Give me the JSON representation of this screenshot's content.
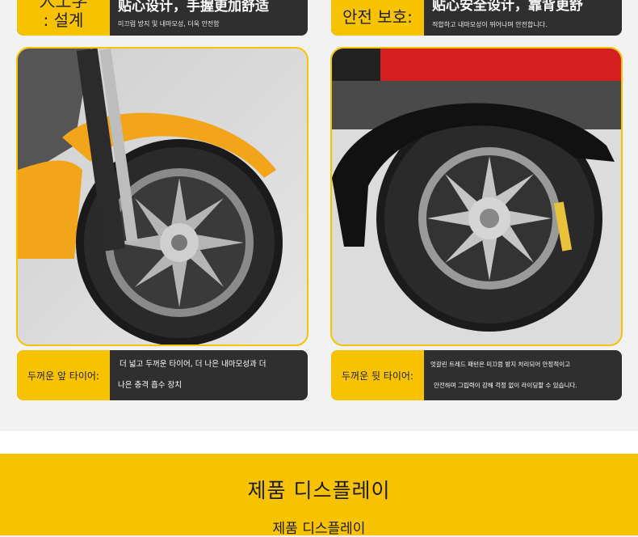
{
  "top_left": {
    "tag_line1": "人工学",
    "tag_line2": ": 설계",
    "title": "贴心设计，手握更加舒适",
    "subtitle": "미끄럼 방지 및 내마모성, 더욱 안전함"
  },
  "top_right": {
    "tag": "안전 보호:",
    "title": "贴心安全设计，靠背更舒",
    "subtitle": "적합하고 내마모성이 뛰어나며 안전합니다."
  },
  "bottom_left": {
    "tag": "두꺼운 앞 타이어:",
    "desc_line1": "더 넓고 두꺼운 타이어, 더 나은 내마모성과 더",
    "desc_line2": "나은 충격 흡수 장치"
  },
  "bottom_right": {
    "tag": "두꺼운 뒷 타이어:",
    "desc_line1": "엇갈린 트레드 패턴은 미끄럼 방지 처리되어 안정적이고",
    "desc_line2": "안전하며 그립력이 강해 걱정 없이 라이딩할 수 있습니다."
  },
  "display": {
    "title": "제품 디스플레이",
    "subtitle": "제품 디스플레이"
  },
  "colors": {
    "accent": "#f7c300",
    "bar_dark": "#2f2f2f",
    "page_bg": "#f2f2f2"
  }
}
